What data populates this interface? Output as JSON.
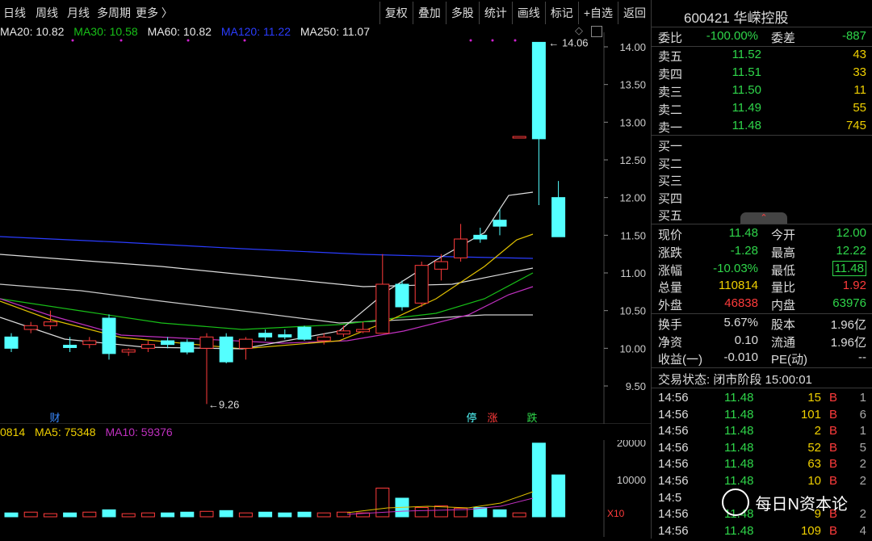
{
  "toolbar": {
    "tabs": [
      "日线",
      "周线",
      "月线",
      "多周期",
      "更多 〉"
    ],
    "tools": [
      "复权",
      "叠加",
      "多股",
      "统计",
      "画线",
      "标记",
      "+自选",
      "返回"
    ]
  },
  "ma": [
    {
      "label": "MA20: 10.82",
      "color": "#e8e8e8"
    },
    {
      "label": "MA30: 10.58",
      "color": "#18c018"
    },
    {
      "label": "MA60: 10.82",
      "color": "#e8e8e8"
    },
    {
      "label": "MA120: 11.22",
      "color": "#2a3cff"
    },
    {
      "label": "MA250: 11.07",
      "color": "#e8e8e8"
    }
  ],
  "vol_legend": [
    {
      "label": "0814",
      "color": "#f0d000"
    },
    {
      "label": "MA5: 75348",
      "color": "#f0d000"
    },
    {
      "label": "MA10: 59376",
      "color": "#c030c0"
    }
  ],
  "chart_data": {
    "type": "candlestick",
    "price_axis": [
      14.0,
      13.5,
      13.0,
      12.5,
      12.0,
      11.5,
      11.0,
      10.5,
      10.0,
      9.5
    ],
    "volume_axis": [
      "20000",
      "10000",
      "X10"
    ],
    "annotations": {
      "high": "14.06",
      "low": "9.26"
    },
    "markers": [
      "财",
      "停",
      "涨",
      "跌"
    ],
    "candles": [
      {
        "o": 10.15,
        "c": 10.0,
        "h": 10.2,
        "l": 9.95
      },
      {
        "o": 10.25,
        "c": 10.3,
        "h": 10.35,
        "l": 10.2
      },
      {
        "o": 10.3,
        "c": 10.35,
        "h": 10.5,
        "l": 10.25
      },
      {
        "o": 10.03,
        "c": 10.02,
        "h": 10.15,
        "l": 9.95
      },
      {
        "o": 10.05,
        "c": 10.1,
        "h": 10.15,
        "l": 10.0
      },
      {
        "o": 10.4,
        "c": 9.93,
        "h": 10.45,
        "l": 9.85
      },
      {
        "o": 9.95,
        "c": 9.98,
        "h": 10.0,
        "l": 9.9
      },
      {
        "o": 10.0,
        "c": 10.05,
        "h": 10.1,
        "l": 9.95
      },
      {
        "o": 10.1,
        "c": 10.05,
        "h": 10.15,
        "l": 10.0
      },
      {
        "o": 10.08,
        "c": 9.95,
        "h": 10.12,
        "l": 9.92
      },
      {
        "o": 10.0,
        "c": 10.15,
        "h": 10.2,
        "l": 9.26
      },
      {
        "o": 10.15,
        "c": 9.82,
        "h": 10.2,
        "l": 9.8
      },
      {
        "o": 10.0,
        "c": 10.12,
        "h": 10.15,
        "l": 9.85
      },
      {
        "o": 10.2,
        "c": 10.15,
        "h": 10.25,
        "l": 10.1
      },
      {
        "o": 10.18,
        "c": 10.15,
        "h": 10.25,
        "l": 10.12
      },
      {
        "o": 10.28,
        "c": 10.12,
        "h": 10.3,
        "l": 10.1
      },
      {
        "o": 10.1,
        "c": 10.15,
        "h": 10.2,
        "l": 10.05
      },
      {
        "o": 10.2,
        "c": 10.22,
        "h": 10.3,
        "l": 10.15
      },
      {
        "o": 10.22,
        "c": 10.25,
        "h": 10.35,
        "l": 10.2
      },
      {
        "o": 10.2,
        "c": 10.85,
        "h": 11.25,
        "l": 10.2
      },
      {
        "o": 10.85,
        "c": 10.55,
        "h": 10.9,
        "l": 10.5
      },
      {
        "o": 10.6,
        "c": 11.1,
        "h": 11.15,
        "l": 10.55
      },
      {
        "o": 11.05,
        "c": 11.15,
        "h": 11.25,
        "l": 10.9
      },
      {
        "o": 11.2,
        "c": 11.45,
        "h": 11.65,
        "l": 11.15
      },
      {
        "o": 11.5,
        "c": 11.45,
        "h": 11.6,
        "l": 11.4
      },
      {
        "o": 11.7,
        "c": 11.62,
        "h": 11.85,
        "l": 11.5
      },
      {
        "o": 12.8,
        "c": 12.8,
        "h": 12.8,
        "l": 12.8
      },
      {
        "o": 14.06,
        "c": 12.78,
        "h": 14.06,
        "l": 11.9
      },
      {
        "o": 12.0,
        "c": 11.48,
        "h": 12.22,
        "l": 11.48
      }
    ],
    "volumes": [
      0.5,
      0.6,
      0.4,
      0.5,
      0.6,
      0.9,
      0.4,
      0.5,
      0.5,
      0.6,
      0.7,
      0.8,
      0.5,
      0.6,
      0.5,
      0.6,
      0.5,
      0.6,
      0.5,
      3.7,
      2.4,
      1.2,
      1.4,
      1.1,
      1.2,
      0.9,
      0.5,
      9.5,
      5.4
    ]
  },
  "quote": {
    "title": "600421 华嵘控股",
    "webi_label": "委比",
    "webi_val": "-100.00%",
    "wecha_label": "委差",
    "wecha_val": "-887",
    "asks": [
      {
        "label": "卖五",
        "price": "11.52",
        "vol": "43"
      },
      {
        "label": "卖四",
        "price": "11.51",
        "vol": "33"
      },
      {
        "label": "卖三",
        "price": "11.50",
        "vol": "11"
      },
      {
        "label": "卖二",
        "price": "11.49",
        "vol": "55"
      },
      {
        "label": "卖一",
        "price": "11.48",
        "vol": "745"
      }
    ],
    "bids": [
      "买一",
      "买二",
      "买三",
      "买四",
      "买五"
    ],
    "stats": [
      {
        "l1": "现价",
        "v1": "11.48",
        "c1": "green",
        "l2": "今开",
        "v2": "12.00",
        "c2": "green"
      },
      {
        "l1": "涨跌",
        "v1": "-1.28",
        "c1": "green",
        "l2": "最高",
        "v2": "12.22",
        "c2": "green"
      },
      {
        "l1": "涨幅",
        "v1": "-10.03%",
        "c1": "green",
        "l2": "最低",
        "v2": "11.48",
        "c2": "green"
      },
      {
        "l1": "总量",
        "v1": "110814",
        "c1": "yellow",
        "l2": "量比",
        "v2": "1.92",
        "c2": "red"
      },
      {
        "l1": "外盘",
        "v1": "46838",
        "c1": "red",
        "l2": "内盘",
        "v2": "63976",
        "c2": "green"
      }
    ],
    "fin": [
      {
        "l1": "换手",
        "v1": "5.67%",
        "l2": "股本",
        "v2": "1.96亿"
      },
      {
        "l1": "净资",
        "v1": "0.10",
        "l2": "流通",
        "v2": "1.96亿"
      },
      {
        "l1": "收益(一)",
        "v1": "-0.010",
        "l2": "PE(动)",
        "v2": "--"
      }
    ],
    "trade_status": "交易状态: 闭市阶段 15:00:01",
    "ticks": [
      {
        "t": "14:56",
        "p": "11.48",
        "v": "15",
        "bs": "B",
        "n": "1"
      },
      {
        "t": "14:56",
        "p": "11.48",
        "v": "101",
        "bs": "B",
        "n": "6"
      },
      {
        "t": "14:56",
        "p": "11.48",
        "v": "2",
        "bs": "B",
        "n": "1"
      },
      {
        "t": "14:56",
        "p": "11.48",
        "v": "52",
        "bs": "B",
        "n": "5"
      },
      {
        "t": "14:56",
        "p": "11.48",
        "v": "63",
        "bs": "B",
        "n": "2"
      },
      {
        "t": "14:56",
        "p": "11.48",
        "v": "10",
        "bs": "B",
        "n": "2"
      },
      {
        "t": "14:5",
        "p": "",
        "v": "",
        "bs": "",
        "n": ""
      },
      {
        "t": "14:56",
        "p": "11.48",
        "v": "9",
        "bs": "B",
        "n": "2"
      },
      {
        "t": "14:56",
        "p": "11.48",
        "v": "109",
        "bs": "B",
        "n": "4"
      }
    ],
    "watermark": "每日N资本论"
  }
}
